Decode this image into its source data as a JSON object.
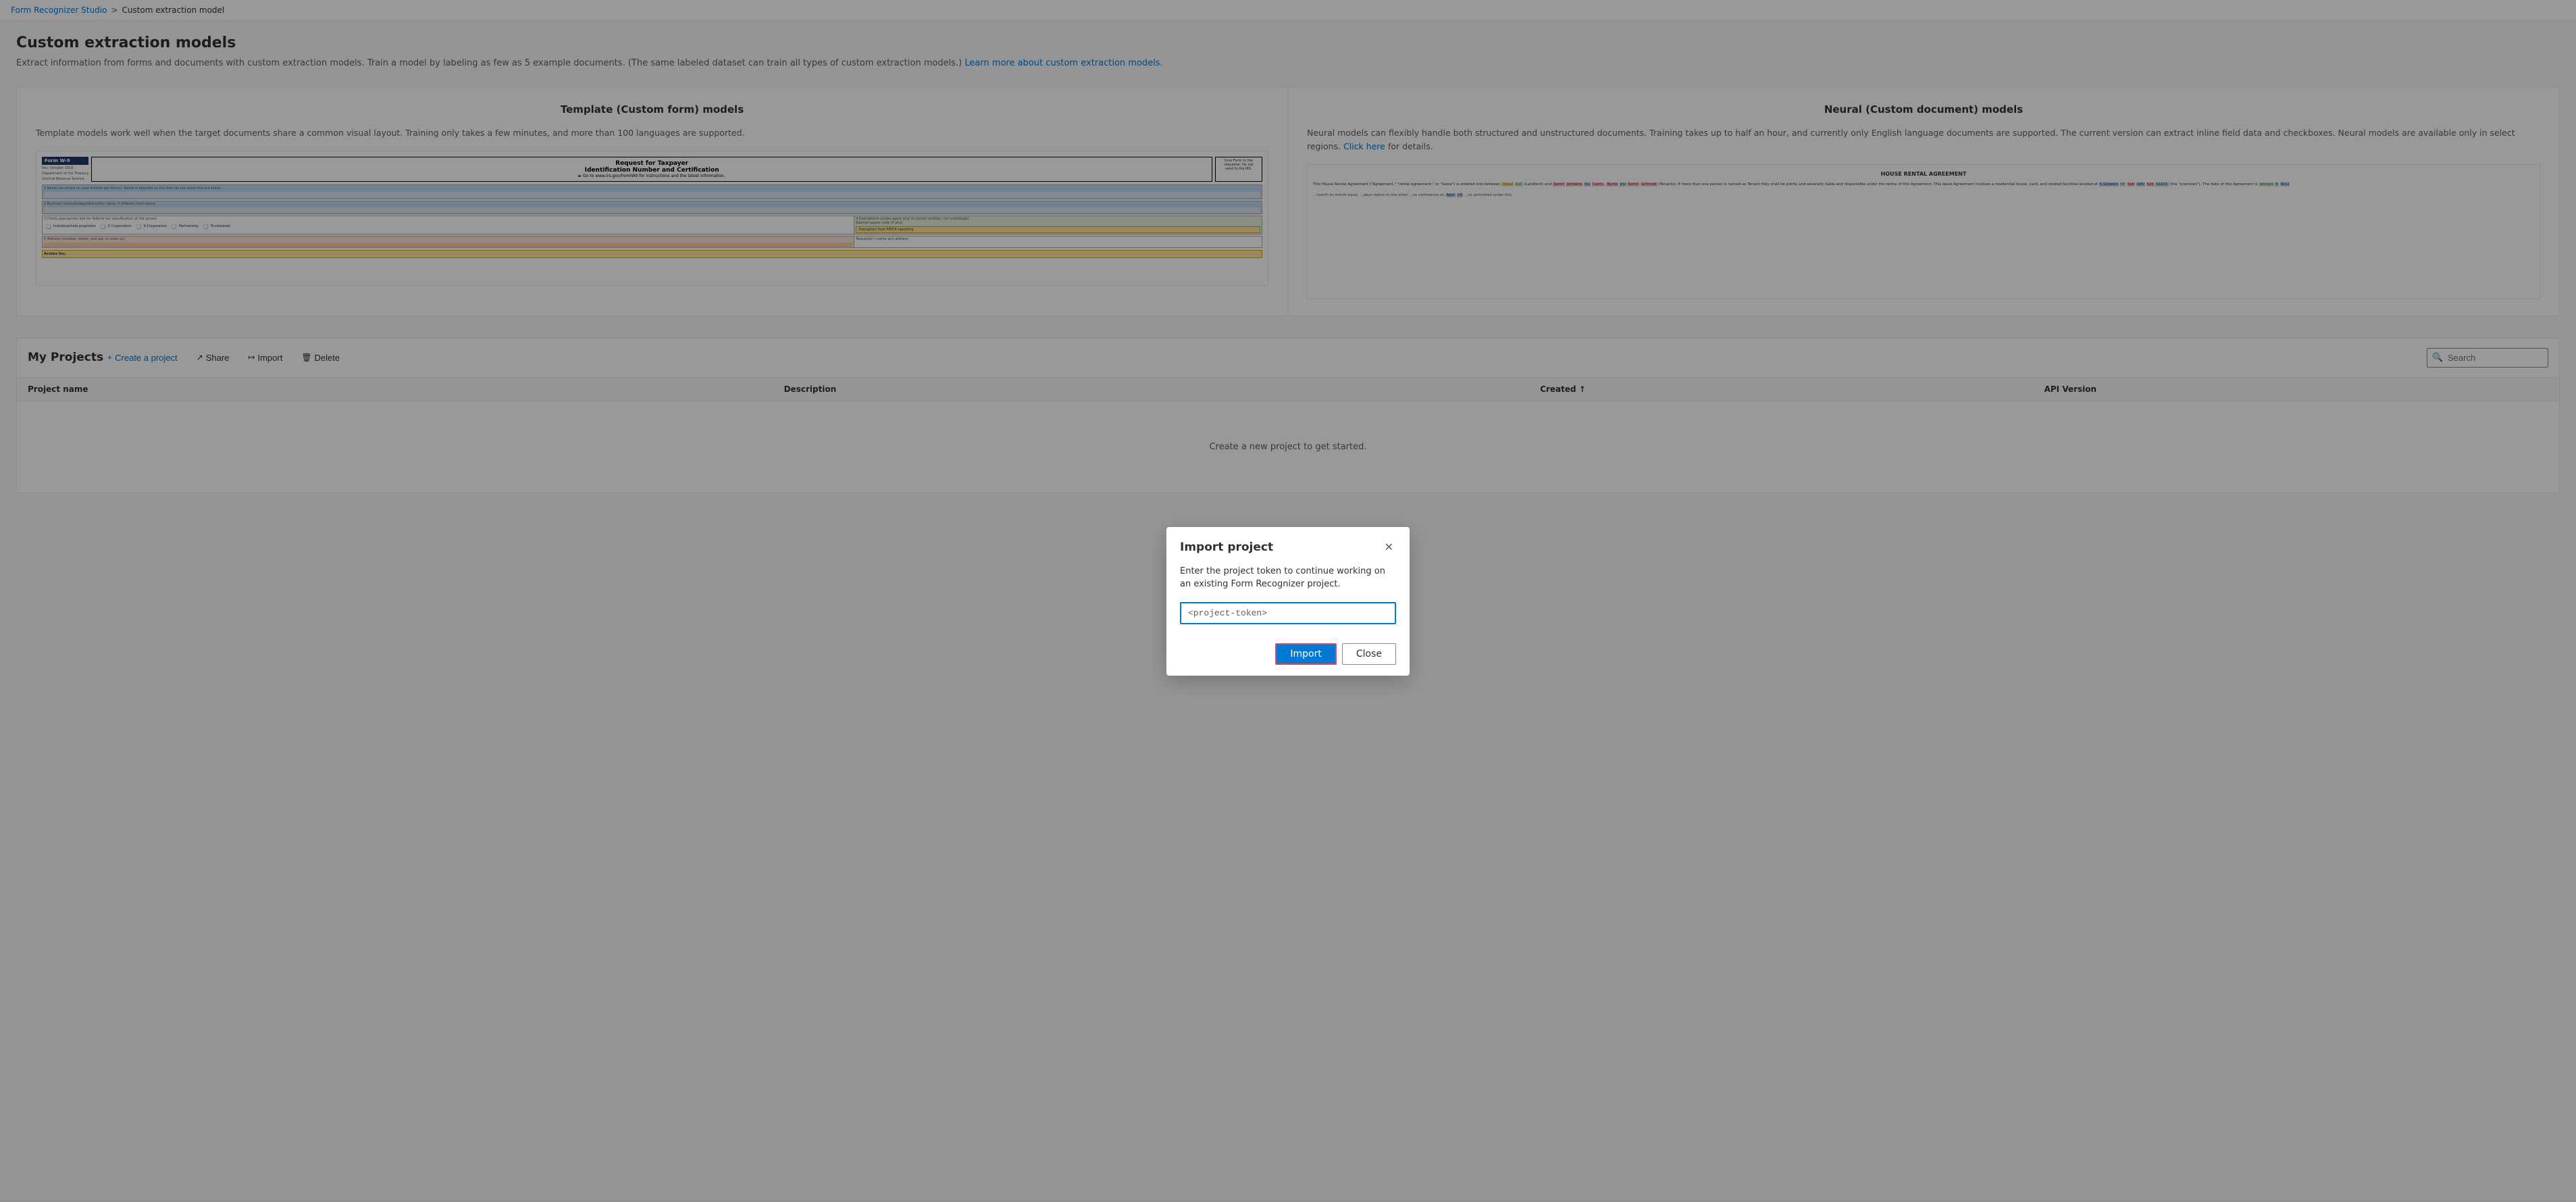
{
  "breadcrumb": {
    "parent_label": "Form Recognizer Studio",
    "parent_url": "#",
    "separator": ">",
    "current_label": "Custom extraction model"
  },
  "page": {
    "title": "Custom extraction models",
    "description": "Extract information from forms and documents with custom extraction models. Train a model by labeling as few as 5 example documents. (The same labeled dataset can train all types of custom extraction models.)",
    "description_link_text": "Learn more about custom extraction models.",
    "description_link_url": "#"
  },
  "model_cards": [
    {
      "id": "template",
      "title": "Template (Custom form) models",
      "description": "Template models work well when the target documents share a common visual layout. Training only takes a few minutes, and more than 100 languages are supported."
    },
    {
      "id": "neural",
      "title": "Neural (Custom document) models",
      "description": "Neural models can flexibly handle both structured and unstructured documents. Training takes up to half an hour, and currently only English language documents are supported. The current version can extract inline field data and checkboxes. Neural models are available only in select regions.",
      "link_text": "Click here",
      "link_url": "#",
      "link_suffix": " for details."
    }
  ],
  "projects_section": {
    "title": "My Projects",
    "actions": [
      {
        "id": "create",
        "label": "Create a project",
        "icon": "+"
      },
      {
        "id": "share",
        "label": "Share",
        "icon": "↗"
      },
      {
        "id": "import",
        "label": "Import",
        "icon": "↦"
      },
      {
        "id": "delete",
        "label": "Delete",
        "icon": "🗑"
      }
    ],
    "search_placeholder": "Search",
    "table": {
      "columns": [
        {
          "id": "project-name",
          "label": "Project name",
          "sortable": false
        },
        {
          "id": "description",
          "label": "Description",
          "sortable": false
        },
        {
          "id": "created",
          "label": "Created ↑",
          "sortable": true
        },
        {
          "id": "api-version",
          "label": "API Version",
          "sortable": false
        }
      ],
      "rows": [],
      "empty_message": "Create a new project to get started."
    }
  },
  "modal": {
    "title": "Import project",
    "description": "Enter the project token to continue working on an existing Form Recognizer project.",
    "input_placeholder": "<project-token>",
    "input_value": "<project-token>",
    "import_button_label": "Import",
    "close_button_label": "Close"
  }
}
